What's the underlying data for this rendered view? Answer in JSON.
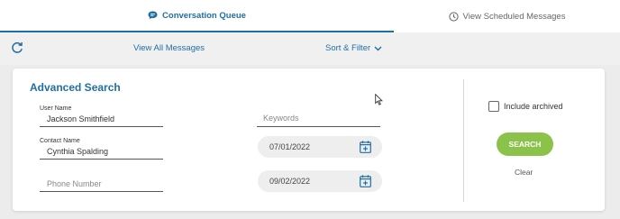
{
  "tabs": {
    "queue_label": "Conversation Queue",
    "scheduled_label": "View Scheduled Messages"
  },
  "toolbar": {
    "refresh_icon": "refresh-icon",
    "view_all_label": "View All Messages",
    "sort_filter_label": "Sort & Filter"
  },
  "search": {
    "title": "Advanced Search",
    "user_name": {
      "label": "User Name",
      "value": "Jackson Smithfield"
    },
    "contact_name": {
      "label": "Contact Name",
      "value": "Cynthia Spalding"
    },
    "phone": {
      "placeholder": "Phone Number"
    },
    "keywords": {
      "placeholder": "Keywords"
    },
    "start_date": "07/01/2022",
    "end_date": "09/02/2022",
    "include_archived_label": "Include archived",
    "include_archived_checked": false,
    "search_label": "SEARCH",
    "clear_label": "Clear"
  },
  "colors": {
    "accent": "#1f6fa3",
    "search_button": "#8bc34a"
  }
}
